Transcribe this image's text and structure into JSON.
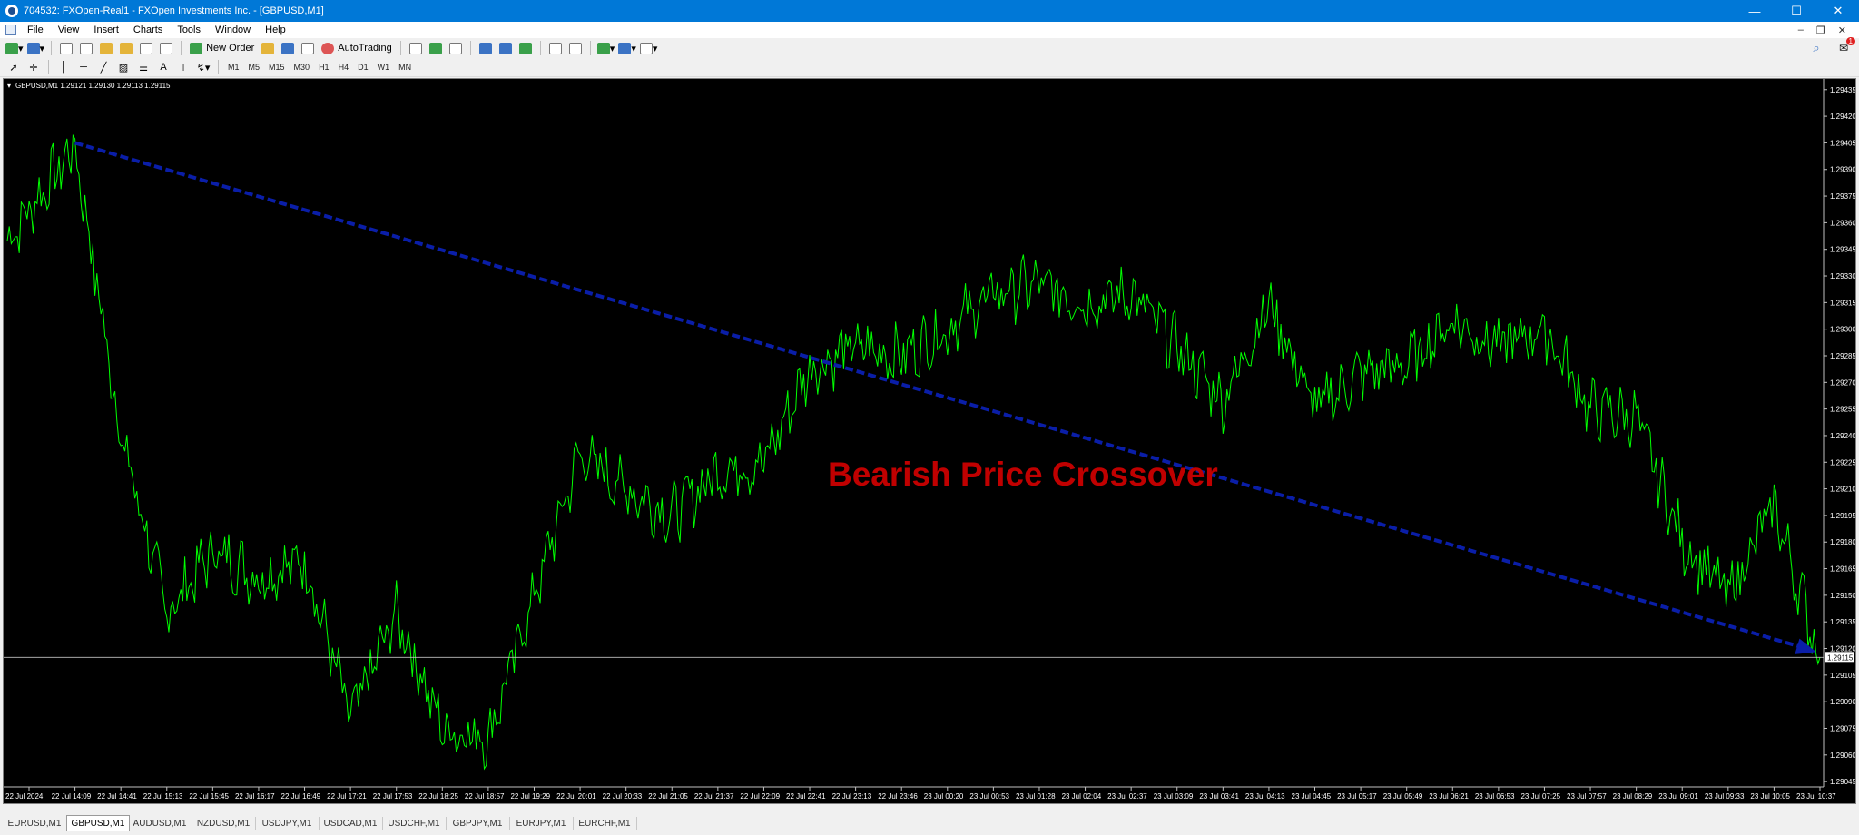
{
  "window": {
    "title": "704532: FXOpen-Real1 - FXOpen Investments Inc. - [GBPUSD,M1]",
    "minimize": "—",
    "maximize": "☐",
    "close": "✕"
  },
  "menu": {
    "items": [
      "File",
      "View",
      "Insert",
      "Charts",
      "Tools",
      "Window",
      "Help"
    ],
    "mdi_minimize": "–",
    "mdi_restore": "❐",
    "mdi_close": "✕"
  },
  "toolbar": {
    "new_order": "New Order",
    "autotrading": "AutoTrading",
    "timeframes": [
      "M1",
      "M5",
      "M15",
      "M30",
      "H1",
      "H4",
      "D1",
      "W1",
      "MN"
    ],
    "notification_count": "1",
    "text_tool": "A"
  },
  "chart": {
    "header": "GBPUSD,M1  1.29121 1.29130 1.29113 1.29115",
    "annotation": "Bearish Price Crossover",
    "current_price": "1.29115",
    "colors": {
      "line": "#00ff00",
      "arrow": "#0a1ea8",
      "annotation": "#c00000",
      "bid_line": "#c0c0c0"
    }
  },
  "chart_data": {
    "type": "line",
    "symbol": "GBPUSD",
    "timeframe": "M1",
    "title": "GBPUSD,M1",
    "ohlc": {
      "open": 1.29121,
      "high": 1.2913,
      "low": 1.29113,
      "close": 1.29115
    },
    "ylim": [
      1.29042,
      1.2944
    ],
    "yticks": [
      "1.29435",
      "1.29420",
      "1.29405",
      "1.29390",
      "1.29375",
      "1.29360",
      "1.29345",
      "1.29330",
      "1.29315",
      "1.29300",
      "1.29285",
      "1.29270",
      "1.29255",
      "1.29240",
      "1.29225",
      "1.29210",
      "1.29195",
      "1.29180",
      "1.29165",
      "1.29150",
      "1.29135",
      "1.29120",
      "1.29105",
      "1.29090",
      "1.29075",
      "1.29060",
      "1.29045"
    ],
    "xticks": [
      "22 Jul 2024",
      "22 Jul 14:09",
      "22 Jul 14:41",
      "22 Jul 15:13",
      "22 Jul 15:45",
      "22 Jul 16:17",
      "22 Jul 16:49",
      "22 Jul 17:21",
      "22 Jul 17:53",
      "22 Jul 18:25",
      "22 Jul 18:57",
      "22 Jul 19:29",
      "22 Jul 20:01",
      "22 Jul 20:33",
      "22 Jul 21:05",
      "22 Jul 21:37",
      "22 Jul 22:09",
      "22 Jul 22:41",
      "22 Jul 23:13",
      "22 Jul 23:46",
      "23 Jul 00:20",
      "23 Jul 00:53",
      "23 Jul 01:28",
      "23 Jul 02:04",
      "23 Jul 02:37",
      "23 Jul 03:09",
      "23 Jul 03:41",
      "23 Jul 04:13",
      "23 Jul 04:45",
      "23 Jul 05:17",
      "23 Jul 05:49",
      "23 Jul 06:21",
      "23 Jul 06:53",
      "23 Jul 07:25",
      "23 Jul 07:57",
      "23 Jul 08:29",
      "23 Jul 09:01",
      "23 Jul 09:33",
      "23 Jul 10:05",
      "23 Jul 10:37"
    ],
    "keypoints": [
      {
        "x": "22 Jul 2024",
        "y": 1.2935
      },
      {
        "x": "22 Jul 14:09",
        "y": 1.29403
      },
      {
        "x": "22 Jul 14:41",
        "y": 1.2924
      },
      {
        "x": "22 Jul 15:13",
        "y": 1.2914
      },
      {
        "x": "22 Jul 15:45",
        "y": 1.29175
      },
      {
        "x": "22 Jul 16:17",
        "y": 1.2916
      },
      {
        "x": "22 Jul 16:49",
        "y": 1.2917
      },
      {
        "x": "22 Jul 17:21",
        "y": 1.2908
      },
      {
        "x": "22 Jul 17:53",
        "y": 1.2914
      },
      {
        "x": "22 Jul 18:25",
        "y": 1.29075
      },
      {
        "x": "22 Jul 18:57",
        "y": 1.2907
      },
      {
        "x": "22 Jul 19:29",
        "y": 1.2915
      },
      {
        "x": "22 Jul 20:01",
        "y": 1.2923
      },
      {
        "x": "22 Jul 20:33",
        "y": 1.2921
      },
      {
        "x": "22 Jul 21:05",
        "y": 1.29195
      },
      {
        "x": "22 Jul 21:37",
        "y": 1.2922
      },
      {
        "x": "22 Jul 22:09",
        "y": 1.29225
      },
      {
        "x": "22 Jul 22:41",
        "y": 1.29278
      },
      {
        "x": "22 Jul 23:13",
        "y": 1.2929
      },
      {
        "x": "22 Jul 23:46",
        "y": 1.29285
      },
      {
        "x": "23 Jul 00:20",
        "y": 1.293
      },
      {
        "x": "23 Jul 00:53",
        "y": 1.2932
      },
      {
        "x": "23 Jul 01:28",
        "y": 1.29325
      },
      {
        "x": "23 Jul 02:04",
        "y": 1.29315
      },
      {
        "x": "23 Jul 02:37",
        "y": 1.2932
      },
      {
        "x": "23 Jul 03:09",
        "y": 1.2929
      },
      {
        "x": "23 Jul 03:41",
        "y": 1.2926
      },
      {
        "x": "23 Jul 04:13",
        "y": 1.29315
      },
      {
        "x": "23 Jul 04:45",
        "y": 1.29255
      },
      {
        "x": "23 Jul 05:17",
        "y": 1.29275
      },
      {
        "x": "23 Jul 05:49",
        "y": 1.2928
      },
      {
        "x": "23 Jul 06:21",
        "y": 1.29305
      },
      {
        "x": "23 Jul 06:53",
        "y": 1.2929
      },
      {
        "x": "23 Jul 07:25",
        "y": 1.293
      },
      {
        "x": "23 Jul 07:57",
        "y": 1.29255
      },
      {
        "x": "23 Jul 08:29",
        "y": 1.2925
      },
      {
        "x": "23 Jul 09:01",
        "y": 1.2918
      },
      {
        "x": "23 Jul 09:33",
        "y": 1.2915
      },
      {
        "x": "23 Jul 10:05",
        "y": 1.292
      },
      {
        "x": "23 Jul 10:37",
        "y": 1.29115
      }
    ],
    "trend_arrow": {
      "from": {
        "x": "22 Jul 14:09",
        "y": 1.29405
      },
      "to": {
        "x": "23 Jul 10:37",
        "y": 1.29118
      }
    },
    "bid_line": 1.29115,
    "grid": false,
    "legend": "none"
  },
  "tabs": [
    "EURUSD,M1",
    "GBPUSD,M1",
    "AUDUSD,M1",
    "NZDUSD,M1",
    "USDJPY,M1",
    "USDCAD,M1",
    "USDCHF,M1",
    "GBPJPY,M1",
    "EURJPY,M1",
    "EURCHF,M1"
  ],
  "active_tab": "GBPUSD,M1"
}
